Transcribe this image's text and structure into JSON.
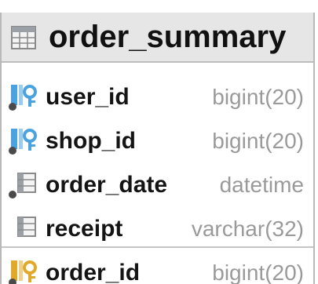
{
  "table": {
    "name": "order_summary",
    "icon": "table-grid-icon",
    "columns": [
      {
        "name": "user_id",
        "type": "bigint(20)",
        "icon": "foreign-key-column-icon"
      },
      {
        "name": "shop_id",
        "type": "bigint(20)",
        "icon": "foreign-key-column-icon"
      },
      {
        "name": "order_date",
        "type": "datetime",
        "icon": "indexed-column-icon"
      },
      {
        "name": "receipt",
        "type": "varchar(32)",
        "icon": "column-icon"
      }
    ],
    "primary_columns": [
      {
        "name": "order_id",
        "type": "bigint(20)",
        "icon": "primary-key-column-icon"
      }
    ]
  },
  "colors": {
    "header_bg": "#e6e6e6",
    "border": "#b9b9b9",
    "name_text": "#141414",
    "type_text": "#9a9a9a",
    "key_gold": "#e0a92a",
    "key_blue": "#4aa3df"
  }
}
